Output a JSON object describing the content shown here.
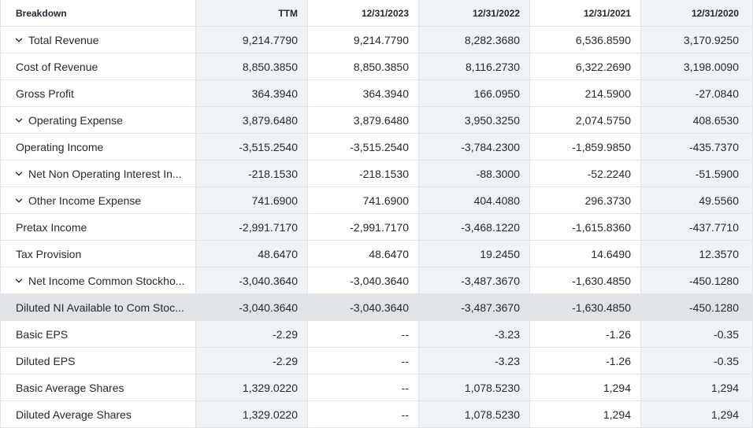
{
  "header": {
    "breakdown": "Breakdown",
    "columns": [
      "TTM",
      "12/31/2023",
      "12/31/2022",
      "12/31/2021",
      "12/31/2020"
    ]
  },
  "rows": [
    {
      "label": "Total Revenue",
      "expandable": true,
      "values": [
        "9,214.7790",
        "9,214.7790",
        "8,282.3680",
        "6,536.8590",
        "3,170.9250"
      ]
    },
    {
      "label": "Cost of Revenue",
      "expandable": false,
      "values": [
        "8,850.3850",
        "8,850.3850",
        "8,116.2730",
        "6,322.2690",
        "3,198.0090"
      ]
    },
    {
      "label": "Gross Profit",
      "expandable": false,
      "values": [
        "364.3940",
        "364.3940",
        "166.0950",
        "214.5900",
        "-27.0840"
      ]
    },
    {
      "label": "Operating Expense",
      "expandable": true,
      "values": [
        "3,879.6480",
        "3,879.6480",
        "3,950.3250",
        "2,074.5750",
        "408.6530"
      ]
    },
    {
      "label": "Operating Income",
      "expandable": false,
      "values": [
        "-3,515.2540",
        "-3,515.2540",
        "-3,784.2300",
        "-1,859.9850",
        "-435.7370"
      ]
    },
    {
      "label": "Net Non Operating Interest In...",
      "expandable": true,
      "values": [
        "-218.1530",
        "-218.1530",
        "-88.3000",
        "-52.2240",
        "-51.5900"
      ]
    },
    {
      "label": "Other Income Expense",
      "expandable": true,
      "values": [
        "741.6900",
        "741.6900",
        "404.4080",
        "296.3730",
        "49.5560"
      ]
    },
    {
      "label": "Pretax Income",
      "expandable": false,
      "values": [
        "-2,991.7170",
        "-2,991.7170",
        "-3,468.1220",
        "-1,615.8360",
        "-437.7710"
      ]
    },
    {
      "label": "Tax Provision",
      "expandable": false,
      "values": [
        "48.6470",
        "48.6470",
        "19.2450",
        "14.6490",
        "12.3570"
      ]
    },
    {
      "label": "Net Income Common Stockho...",
      "expandable": true,
      "values": [
        "-3,040.3640",
        "-3,040.3640",
        "-3,487.3670",
        "-1,630.4850",
        "-450.1280"
      ]
    },
    {
      "label": "Diluted NI Available to Com Stoc...",
      "expandable": false,
      "highlight": true,
      "values": [
        "-3,040.3640",
        "-3,040.3640",
        "-3,487.3670",
        "-1,630.4850",
        "-450.1280"
      ]
    },
    {
      "label": "Basic EPS",
      "expandable": false,
      "values": [
        "-2.29",
        "--",
        "-3.23",
        "-1.26",
        "-0.35"
      ]
    },
    {
      "label": "Diluted EPS",
      "expandable": false,
      "values": [
        "-2.29",
        "--",
        "-3.23",
        "-1.26",
        "-0.35"
      ]
    },
    {
      "label": "Basic Average Shares",
      "expandable": false,
      "values": [
        "1,329.0220",
        "--",
        "1,078.5230",
        "1,294",
        "1,294"
      ]
    },
    {
      "label": "Diluted Average Shares",
      "expandable": false,
      "values": [
        "1,329.0220",
        "--",
        "1,078.5230",
        "1,294",
        "1,294"
      ]
    }
  ]
}
